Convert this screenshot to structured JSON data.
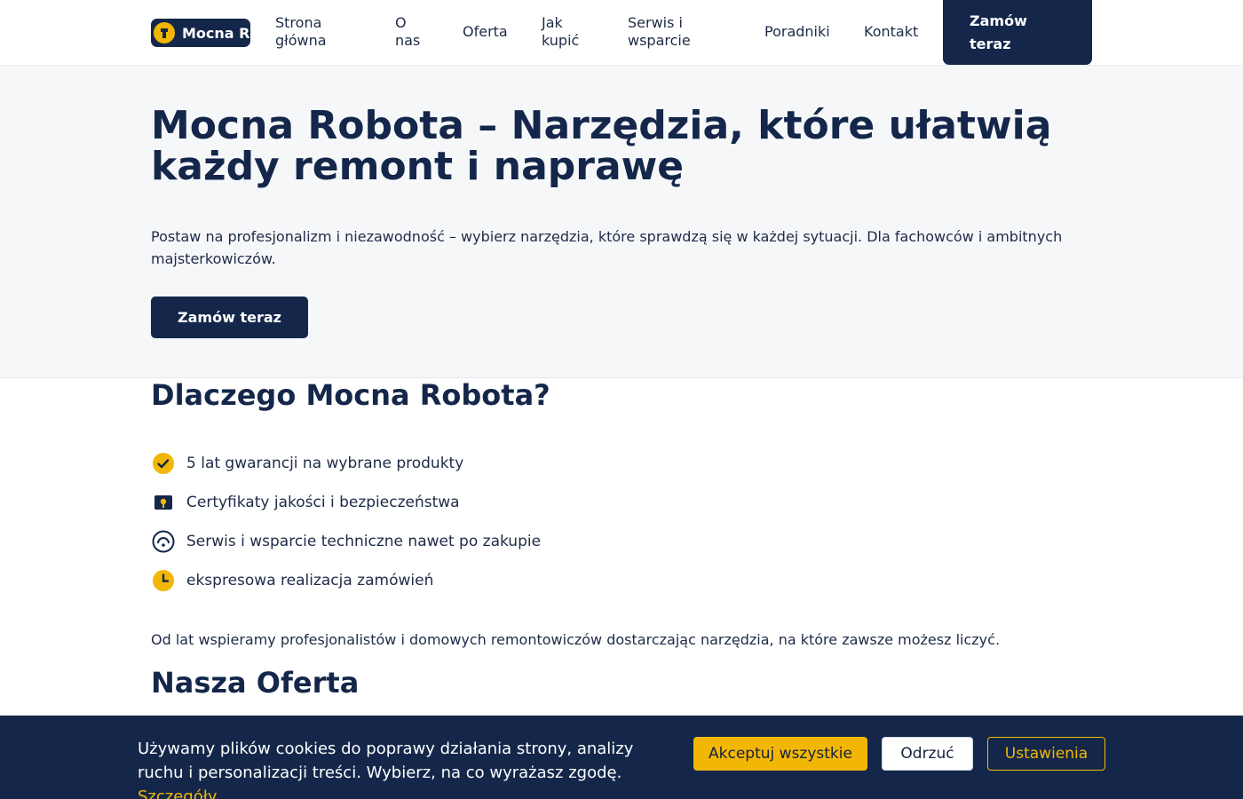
{
  "header": {
    "logo_text": "Mocna Robota",
    "nav": [
      {
        "label": "Strona\ngłówna"
      },
      {
        "label": "O\nnas"
      },
      {
        "label": "Oferta"
      },
      {
        "label": "Jak\nkupić"
      },
      {
        "label": "Serwis i\nwsparcie"
      },
      {
        "label": "Poradniki"
      },
      {
        "label": "Kontakt"
      }
    ],
    "cta_label": "Zamów\nteraz"
  },
  "hero": {
    "title": "Mocna Robota – Narzędzia, które ułatwią każdy remont i naprawę",
    "text": "Postaw na profesjonalizm i niezawodność – wybierz narzędzia, które sprawdzą się w każdej sytuacji. Dla fachowców i ambitnych majsterkowiczów.",
    "button_label": "Zamów teraz"
  },
  "why": {
    "title": "Dlaczego Mocna Robota?",
    "features": [
      {
        "icon": "check-badge-icon",
        "text": "5 lat gwarancji na wybrane produkty"
      },
      {
        "icon": "certificate-icon",
        "text": "Certyfikaty jakości i bezpieczeństwa"
      },
      {
        "icon": "support-icon",
        "text": "Serwis i wsparcie techniczne nawet po zakupie"
      },
      {
        "icon": "clock-icon",
        "text": "ekspresowa realizacja zamówień"
      }
    ],
    "paragraph": "Od lat wspieramy profesjonalistów i domowych remontowiczów dostarczając narzędzia, na które zawsze możesz liczyć."
  },
  "offer": {
    "title": "Nasza Oferta"
  },
  "cookie": {
    "text": "Używamy plików cookies do poprawy działania strony, analizy ruchu i personalizacji treści. Wybierz, na co wyrażasz zgodę.",
    "link_label": "Szczegóły",
    "accept_label": "Akceptuj wszystkie",
    "reject_label": "Odrzuć",
    "settings_label": "Ustawienia"
  },
  "colors": {
    "navy": "#14274a",
    "accent": "#f2b705",
    "hero_bg": "#f6f7f9"
  }
}
